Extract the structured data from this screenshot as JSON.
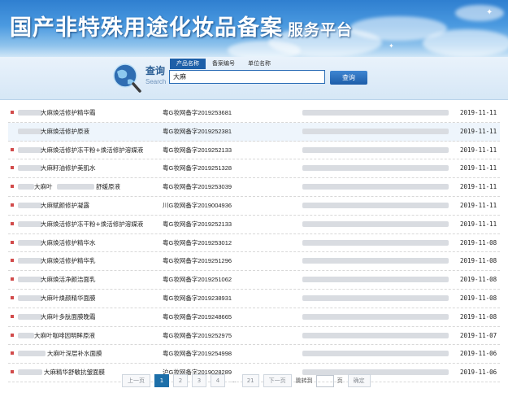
{
  "header": {
    "title": "国产非特殊用途化妆品备案",
    "subtitle": "服务平台"
  },
  "search": {
    "label": "查询",
    "label_en": "Search",
    "tabs": [
      "产品名称",
      "备案编号",
      "单位名称"
    ],
    "active_tab": 0,
    "value": "大麻",
    "button": "查询"
  },
  "rows": [
    {
      "name": "大麻焕活修护精华霜",
      "reg": "粤G妆网备字2019253681",
      "date": "2019-11-11",
      "bullet": true
    },
    {
      "name": "大麻焕活修护原液",
      "reg": "粤G妆网备字2019252381",
      "date": "2019-11-11",
      "bullet": false
    },
    {
      "name": "大麻焕活修护冻干粉+焕活修护溶媒液",
      "reg": "粤G妆网备字2019252133",
      "date": "2019-11-11",
      "bullet": true
    },
    {
      "name": "大麻籽油修护美肌水",
      "reg": "粤G妆网备字2019251328",
      "date": "2019-11-11",
      "bullet": true
    },
    {
      "name": "大麻叶",
      "name_suffix": "舒缓原液",
      "reg": "粤G妆网备字2019253039",
      "date": "2019-11-11",
      "bullet": true
    },
    {
      "name": "大麻赋颜修护凝露",
      "reg": "川G妆网备字2019004936",
      "date": "2019-11-11",
      "bullet": true
    },
    {
      "name": "大麻焕活修护冻干粉+焕活修护溶媒液",
      "reg": "粤G妆网备字2019252133",
      "date": "2019-11-11",
      "bullet": true
    },
    {
      "name": "大麻焕活修护精华水",
      "reg": "粤G妆网备字2019253012",
      "date": "2019-11-08",
      "bullet": true
    },
    {
      "name": "大麻焕活修护精华乳",
      "reg": "粤G妆网备字2019251296",
      "date": "2019-11-08",
      "bullet": true
    },
    {
      "name": "大麻焕活净颜洁面乳",
      "reg": "粤G妆网备字2019251062",
      "date": "2019-11-08",
      "bullet": true
    },
    {
      "name": "大麻叶焕颜精华面膜",
      "reg": "粤G妆网备字2019238931",
      "date": "2019-11-08",
      "bullet": true
    },
    {
      "name": "大麻叶多肽面膜晚霜",
      "reg": "粤G妆网备字2019248665",
      "date": "2019-11-08",
      "bullet": true
    },
    {
      "name": "大麻叶咖啡因明眸原液",
      "reg": "粤G妆网备字2019252975",
      "date": "2019-11-07",
      "bullet": true
    },
    {
      "name": "大麻叶深层补水面膜",
      "reg": "粤G妆网备字2019254998",
      "date": "2019-11-06",
      "bullet": true
    },
    {
      "name": "大麻精华舒敏抗皱面膜",
      "reg": "沪G妆网备字2019028289",
      "date": "2019-11-06",
      "bullet": true
    }
  ],
  "pager": {
    "prev": "上一页",
    "pages": [
      "1",
      "2",
      "3",
      "4"
    ],
    "dots": "...",
    "last": "21",
    "next": "下一页",
    "jump_label": "跳转到",
    "page_unit": "页",
    "confirm": "确定",
    "current": "1"
  },
  "colors": {
    "accent": "#1d5fa8",
    "bullet": "#d24b4b",
    "current_page": "#1d6fa9"
  }
}
